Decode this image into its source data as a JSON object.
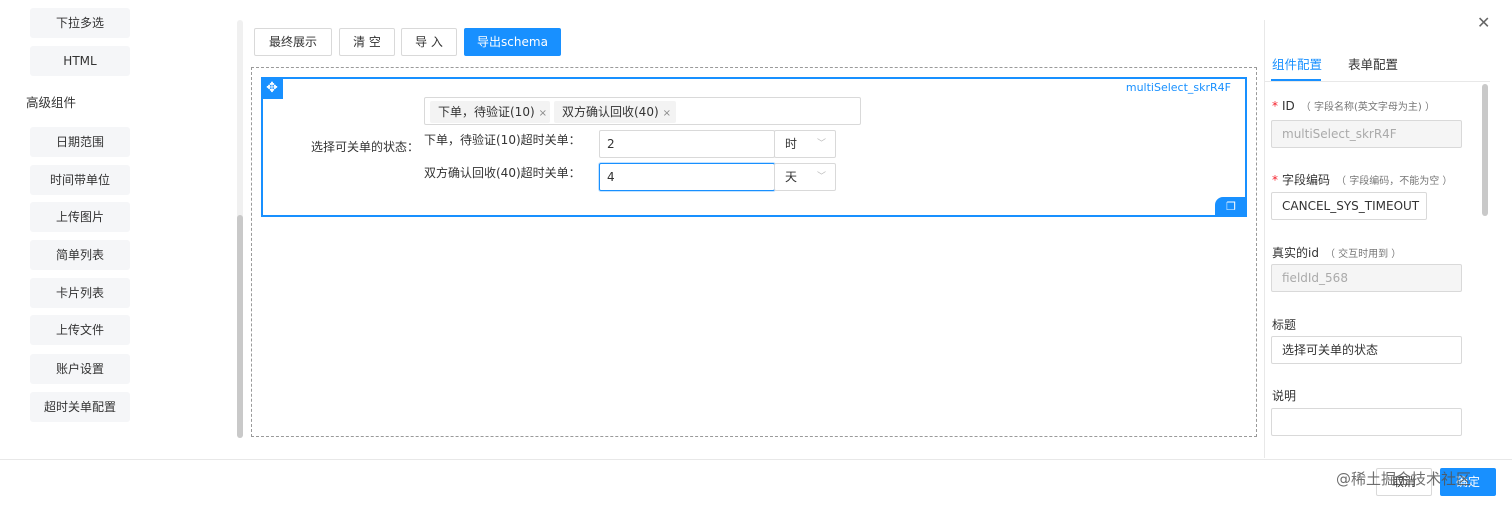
{
  "sidebar": {
    "basic_items": [
      {
        "label": "下拉多选"
      },
      {
        "label": "HTML"
      }
    ],
    "advanced_title": "高级组件",
    "advanced_items": [
      {
        "label": "日期范围"
      },
      {
        "label": "时间带单位"
      },
      {
        "label": "上传图片"
      },
      {
        "label": "简单列表"
      },
      {
        "label": "卡片列表"
      },
      {
        "label": "上传文件"
      },
      {
        "label": "账户设置"
      },
      {
        "label": "超时关单配置"
      }
    ]
  },
  "toolbar": {
    "preview": "最终展示",
    "clear": "清 空",
    "import": "导 入",
    "export": "导出schema"
  },
  "canvas": {
    "field_id": "multiSelect_skrR4F",
    "drag_icon": "plus-move-icon",
    "copy_icon": "copy-icon",
    "label": "选择可关单的状态：",
    "selected_tags": [
      {
        "label": "下单，待验证(10)"
      },
      {
        "label": "双方确认回收(40)"
      }
    ],
    "rows": [
      {
        "label": "下单，待验证(10)超时关单：",
        "value": "2",
        "unit": "时"
      },
      {
        "label": "双方确认回收(40)超时关单：",
        "value": "4",
        "unit": "天"
      }
    ]
  },
  "panel": {
    "tabs": [
      {
        "label": "组件配置"
      },
      {
        "label": "表单配置"
      }
    ],
    "id": {
      "label": "ID",
      "hint": "（ 字段名称(英文字母为主) ）",
      "value": "multiSelect_skrR4F"
    },
    "field_code": {
      "label": "字段编码",
      "hint": "（ 字段编码，不能为空 ）",
      "value": "CANCEL_SYS_TIMEOUT"
    },
    "real_id": {
      "label": "真实的id",
      "hint": "（ 交互时用到 ）",
      "value": "fieldId_568"
    },
    "title": {
      "label": "标题",
      "value": "选择可关单的状态"
    },
    "desc": {
      "label": "说明",
      "value": ""
    }
  },
  "footer": {
    "cancel": "取消",
    "ok": "确定",
    "watermark": "@稀土掘金技术社区"
  },
  "colors": {
    "accent": "#1890ff",
    "required": "#f5222d"
  }
}
